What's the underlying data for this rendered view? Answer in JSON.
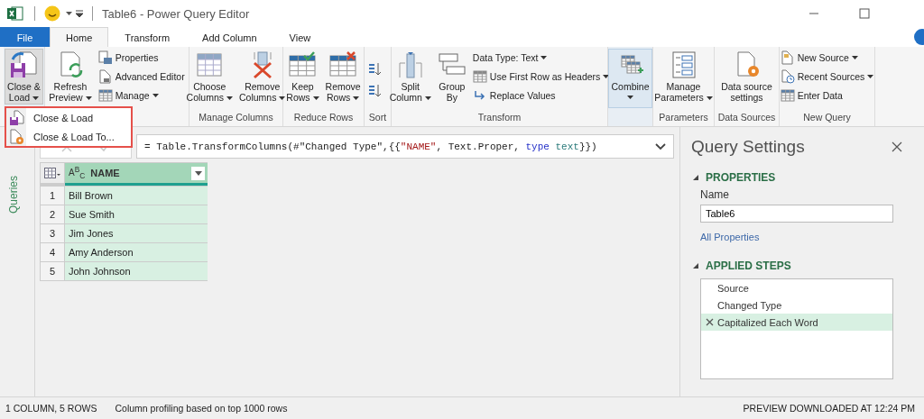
{
  "title_bar": {
    "title": "Table6 - Power Query Editor"
  },
  "tabs": [
    {
      "label": "File",
      "kind": "file",
      "selected": false
    },
    {
      "label": "Home",
      "kind": "tab",
      "selected": true
    },
    {
      "label": "Transform",
      "kind": "tab",
      "selected": false
    },
    {
      "label": "Add Column",
      "kind": "tab",
      "selected": false
    },
    {
      "label": "View",
      "kind": "tab",
      "selected": false
    }
  ],
  "ribbon": [
    {
      "items": [
        {
          "kind": "large",
          "lines": [
            "Close &",
            "Load"
          ],
          "dropdown": true,
          "pressed": true
        }
      ]
    },
    {
      "items": [
        {
          "kind": "large",
          "lines": [
            "Refresh",
            "Preview"
          ],
          "dropdown": true,
          "pressed": false
        },
        {
          "kind": "small",
          "label": "Properties",
          "pressed": false
        },
        {
          "kind": "small",
          "label": "Advanced Editor",
          "pressed": false
        },
        {
          "kind": "small",
          "label": "Manage",
          "dropdown": true,
          "pressed": false
        }
      ]
    },
    {
      "label": "Manage Columns",
      "items": [
        {
          "kind": "large",
          "lines": [
            "Choose",
            "Columns"
          ],
          "dropdown": true,
          "pressed": false
        },
        {
          "kind": "large",
          "lines": [
            "Remove",
            "Columns"
          ],
          "dropdown": true,
          "pressed": false
        }
      ]
    },
    {
      "label": "Reduce Rows",
      "items": [
        {
          "kind": "large",
          "lines": [
            "Keep",
            "Rows"
          ],
          "dropdown": true,
          "pressed": false
        },
        {
          "kind": "large",
          "lines": [
            "Remove",
            "Rows"
          ],
          "dropdown": true,
          "pressed": false
        }
      ]
    },
    {
      "label": "Sort",
      "items": [
        {
          "kind": "icon",
          "pressed": false
        },
        {
          "kind": "icon",
          "pressed": false
        }
      ]
    },
    {
      "label": "Transform",
      "items": [
        {
          "kind": "large",
          "lines": [
            "Split",
            "Column"
          ],
          "dropdown": true,
          "pressed": false
        },
        {
          "kind": "large",
          "lines": [
            "Group",
            "By"
          ],
          "pressed": false
        },
        {
          "kind": "small",
          "label": "Data Type: Text",
          "dropdown": true,
          "pressed": false
        },
        {
          "kind": "small",
          "label": "Use First Row as Headers",
          "dropdown": true,
          "pressed": false
        },
        {
          "kind": "small",
          "label": "Replace Values",
          "pressed": false
        }
      ]
    },
    {
      "items": [
        {
          "kind": "large",
          "lines": [
            "Combine"
          ],
          "dropdown": true,
          "pressed": true
        }
      ]
    },
    {
      "label": "Parameters",
      "items": [
        {
          "kind": "large",
          "lines": [
            "Manage",
            "Parameters"
          ],
          "dropdown": true,
          "pressed": false
        }
      ]
    },
    {
      "label": "Data Sources",
      "items": [
        {
          "kind": "large",
          "lines": [
            "Data source",
            "settings"
          ],
          "pressed": false
        }
      ]
    },
    {
      "label": "New Query",
      "items": [
        {
          "kind": "small",
          "label": "New Source",
          "dropdown": true,
          "pressed": false
        },
        {
          "kind": "small",
          "label": "Recent Sources",
          "dropdown": true,
          "pressed": false
        },
        {
          "kind": "small",
          "label": "Enter Data",
          "pressed": false
        }
      ]
    }
  ],
  "close_load_menu": {
    "items": [
      {
        "label": "Close & Load"
      },
      {
        "label": "Close & Load To..."
      }
    ]
  },
  "queries_pane": {
    "label": "Queries"
  },
  "formula": [
    {
      "text": "= Table.TransformColumns(#\"Changed Type\",{{",
      "kind": "plain"
    },
    {
      "text": "\"NAME\"",
      "kind": "string"
    },
    {
      "text": ", Text.Proper, ",
      "kind": "plain"
    },
    {
      "text": "type",
      "kind": "keyword"
    },
    {
      "text": " text",
      "kind": "typename"
    },
    {
      "text": "}})",
      "kind": "plain"
    }
  ],
  "table": {
    "column": {
      "type_label": "A$^{B}$$_{C}$",
      "name": "NAME"
    },
    "rows": [
      {
        "index": "1",
        "name": "Bill Brown"
      },
      {
        "index": "2",
        "name": "Sue Smith"
      },
      {
        "index": "3",
        "name": "Jim Jones"
      },
      {
        "index": "4",
        "name": "Amy Anderson"
      },
      {
        "index": "5",
        "name": "John Johnson"
      }
    ]
  },
  "query_settings": {
    "title": "Query Settings",
    "properties": {
      "heading": "PROPERTIES",
      "expanded": true,
      "name_label": "Name",
      "name_value": "Table6",
      "link": "All Properties"
    },
    "applied_steps": {
      "heading": "APPLIED STEPS",
      "expanded": true,
      "steps": [
        {
          "label": "Source",
          "selected": false
        },
        {
          "label": "Changed Type",
          "selected": false
        },
        {
          "label": "Capitalized Each Word",
          "selected": true
        }
      ]
    }
  },
  "status_bar": {
    "left": [
      "1 COLUMN, 5 ROWS",
      "Column profiling based on top 1000 rows"
    ],
    "right": "PREVIEW DOWNLOADED AT 12:24 PM"
  }
}
